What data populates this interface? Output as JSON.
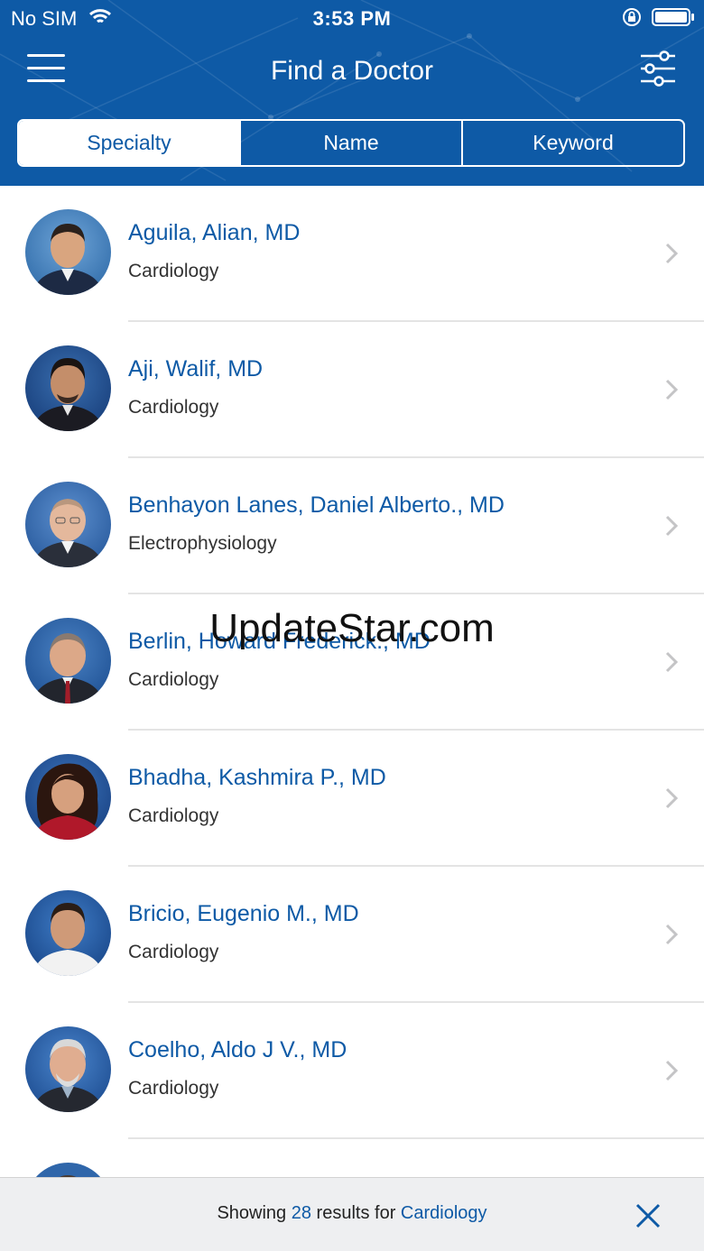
{
  "status_bar": {
    "carrier": "No SIM",
    "time": "3:53 PM"
  },
  "header": {
    "title": "Find a Doctor",
    "menu_icon": "hamburger-menu-icon",
    "filter_icon": "sliders-icon",
    "background_color": "#0e5aa6"
  },
  "tabs": [
    {
      "label": "Specialty",
      "active": true
    },
    {
      "label": "Name",
      "active": false
    },
    {
      "label": "Keyword",
      "active": false
    }
  ],
  "doctors": [
    {
      "name": "Aguila, Alian, MD",
      "specialty": "Cardiology"
    },
    {
      "name": "Aji, Walif, MD",
      "specialty": "Cardiology"
    },
    {
      "name": "Benhayon Lanes, Daniel Alberto., MD",
      "specialty": "Electrophysiology"
    },
    {
      "name": "Berlin, Howard Frederick., MD",
      "specialty": "Cardiology"
    },
    {
      "name": "Bhadha, Kashmira P., MD",
      "specialty": "Cardiology"
    },
    {
      "name": "Bricio, Eugenio M., MD",
      "specialty": "Cardiology"
    },
    {
      "name": "Coelho, Aldo J V., MD",
      "specialty": "Cardiology"
    }
  ],
  "watermark": "UpdateStar.com",
  "footer": {
    "prefix": "Showing",
    "count": "28",
    "middle": "results for",
    "query": "Cardiology",
    "close_icon": "close-icon"
  },
  "colors": {
    "brand_blue": "#0e5aa6",
    "footer_bg": "#eeeff1"
  }
}
